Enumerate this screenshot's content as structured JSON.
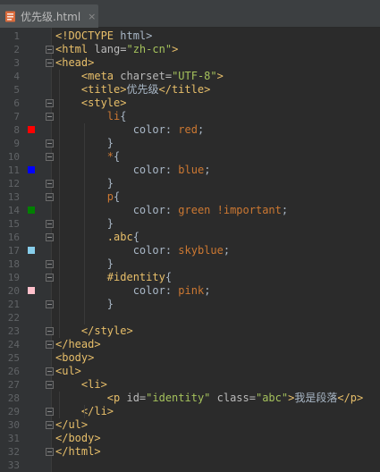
{
  "tab": {
    "title": "优先级.html",
    "close_glyph": "×",
    "icon": "html-file-icon"
  },
  "swatches": {
    "red": "#ff0000",
    "blue": "#0000ff",
    "green": "#008000",
    "skyblue": "#87ceeb",
    "pink": "#ffc0cb"
  },
  "lines": [
    {
      "n": "1",
      "segments": [
        [
          "tag",
          "<!DOCTYPE"
        ],
        [
          "txt",
          " html>"
        ]
      ]
    },
    {
      "n": "2",
      "segments": [
        [
          "tag",
          "<html"
        ],
        [
          "attr",
          " lang="
        ],
        [
          "str",
          "\"zh-cn\""
        ],
        [
          "tag",
          ">"
        ]
      ]
    },
    {
      "n": "3",
      "segments": [
        [
          "tag",
          "<head>"
        ]
      ]
    },
    {
      "n": "4",
      "segments": [
        [
          "txt",
          "    "
        ],
        [
          "tag",
          "<meta"
        ],
        [
          "attr",
          " charset="
        ],
        [
          "str",
          "\"UTF-8\""
        ],
        [
          "tag",
          ">"
        ]
      ]
    },
    {
      "n": "5",
      "segments": [
        [
          "txt",
          "    "
        ],
        [
          "tag",
          "<title>"
        ],
        [
          "txt",
          "优先级"
        ],
        [
          "tag",
          "</title>"
        ]
      ]
    },
    {
      "n": "6",
      "segments": [
        [
          "txt",
          "    "
        ],
        [
          "tag",
          "<style>"
        ]
      ]
    },
    {
      "n": "7",
      "segments": [
        [
          "txt",
          "        "
        ],
        [
          "kw",
          "li"
        ],
        [
          "txt",
          "{"
        ]
      ]
    },
    {
      "n": "8",
      "segments": [
        [
          "txt",
          "            "
        ],
        [
          "prop",
          "color"
        ],
        [
          "txt",
          ": "
        ],
        [
          "kw",
          "red"
        ],
        [
          "txt",
          ";"
        ]
      ]
    },
    {
      "n": "9",
      "segments": [
        [
          "txt",
          "        }"
        ]
      ]
    },
    {
      "n": "10",
      "segments": [
        [
          "txt",
          "        "
        ],
        [
          "kw",
          "*"
        ],
        [
          "txt",
          "{"
        ]
      ]
    },
    {
      "n": "11",
      "segments": [
        [
          "txt",
          "            "
        ],
        [
          "prop",
          "color"
        ],
        [
          "txt",
          ": "
        ],
        [
          "kw",
          "blue"
        ],
        [
          "txt",
          ";"
        ]
      ]
    },
    {
      "n": "12",
      "segments": [
        [
          "txt",
          "        }"
        ]
      ]
    },
    {
      "n": "13",
      "segments": [
        [
          "txt",
          "        "
        ],
        [
          "kw",
          "p"
        ],
        [
          "txt",
          "{"
        ]
      ]
    },
    {
      "n": "14",
      "segments": [
        [
          "txt",
          "            "
        ],
        [
          "prop",
          "color"
        ],
        [
          "txt",
          ": "
        ],
        [
          "kw",
          "green !important"
        ],
        [
          "txt",
          ";"
        ]
      ]
    },
    {
      "n": "15",
      "segments": [
        [
          "txt",
          "        }"
        ]
      ]
    },
    {
      "n": "16",
      "segments": [
        [
          "txt",
          "        "
        ],
        [
          "sel",
          ".abc"
        ],
        [
          "txt",
          "{"
        ]
      ]
    },
    {
      "n": "17",
      "segments": [
        [
          "txt",
          "            "
        ],
        [
          "prop",
          "color"
        ],
        [
          "txt",
          ": "
        ],
        [
          "kw",
          "skyblue"
        ],
        [
          "txt",
          ";"
        ]
      ]
    },
    {
      "n": "18",
      "segments": [
        [
          "txt",
          "        }"
        ]
      ]
    },
    {
      "n": "19",
      "segments": [
        [
          "txt",
          "        "
        ],
        [
          "sel",
          "#identity"
        ],
        [
          "txt",
          "{"
        ]
      ]
    },
    {
      "n": "20",
      "segments": [
        [
          "txt",
          "            "
        ],
        [
          "prop",
          "color"
        ],
        [
          "txt",
          ": "
        ],
        [
          "kw",
          "pink"
        ],
        [
          "txt",
          ";"
        ]
      ]
    },
    {
      "n": "21",
      "segments": [
        [
          "txt",
          "        }"
        ]
      ]
    },
    {
      "n": "22",
      "segments": []
    },
    {
      "n": "23",
      "segments": [
        [
          "txt",
          "    "
        ],
        [
          "tag",
          "</style>"
        ]
      ]
    },
    {
      "n": "24",
      "segments": [
        [
          "tag",
          "</head>"
        ]
      ]
    },
    {
      "n": "25",
      "segments": [
        [
          "tag",
          "<body>"
        ]
      ]
    },
    {
      "n": "26",
      "segments": [
        [
          "tag",
          "<ul>"
        ]
      ]
    },
    {
      "n": "27",
      "segments": [
        [
          "txt",
          "    "
        ],
        [
          "tag",
          "<li>"
        ]
      ]
    },
    {
      "n": "28",
      "segments": [
        [
          "txt",
          "        "
        ],
        [
          "tag",
          "<p"
        ],
        [
          "attr",
          " id="
        ],
        [
          "str",
          "\"identity\""
        ],
        [
          "attr",
          " class="
        ],
        [
          "str",
          "\"abc\""
        ],
        [
          "tag",
          ">"
        ],
        [
          "txt",
          "我是段落"
        ],
        [
          "tag",
          "</p>"
        ]
      ]
    },
    {
      "n": "29",
      "segments": [
        [
          "txt",
          "    "
        ],
        [
          "tag",
          "</li>"
        ]
      ]
    },
    {
      "n": "30",
      "segments": [
        [
          "tag",
          "</ul>"
        ]
      ]
    },
    {
      "n": "31",
      "segments": [
        [
          "tag",
          "</body>"
        ]
      ]
    },
    {
      "n": "32",
      "segments": [
        [
          "tag",
          "</html>"
        ]
      ]
    },
    {
      "n": "33",
      "segments": []
    }
  ]
}
